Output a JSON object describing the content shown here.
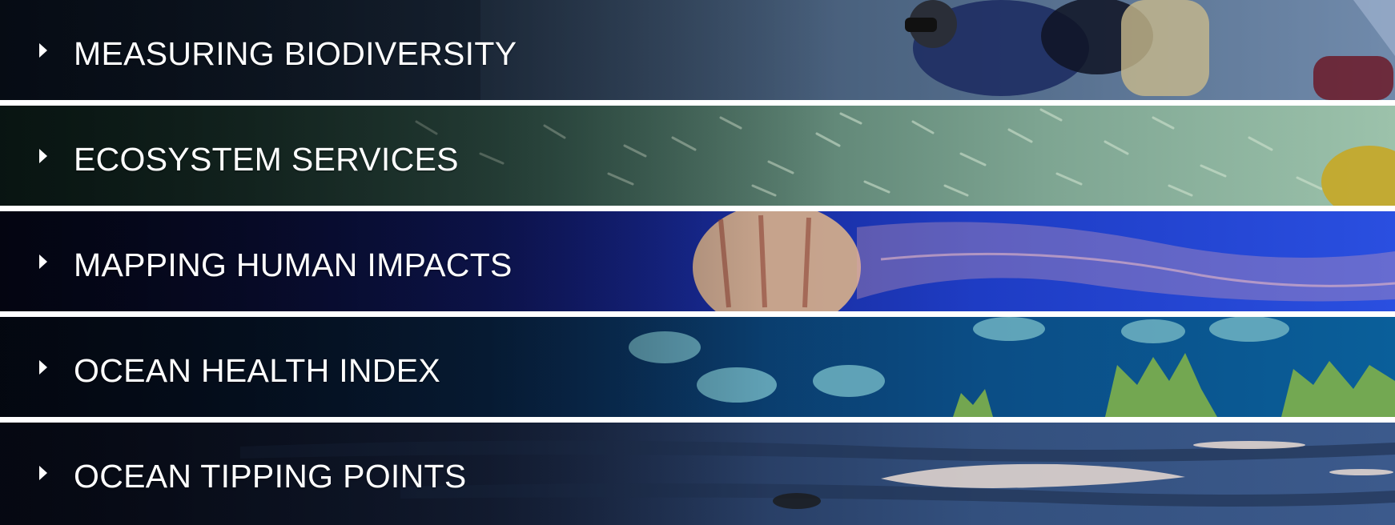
{
  "banners": [
    {
      "label": "MEASURING BIODIVERSITY",
      "image": "scuba-diver-photo",
      "colors": {
        "left": "#0e1826",
        "mid": "#3d5571",
        "right": "#6c84a6"
      }
    },
    {
      "label": "ECOSYSTEM SERVICES",
      "image": "fish-school-photo",
      "colors": {
        "left": "#13261f",
        "mid": "#4f7468",
        "right": "#8fb7a0"
      }
    },
    {
      "label": "MAPPING HUMAN IMPACTS",
      "image": "jellyfish-photo",
      "colors": {
        "left": "#070a1c",
        "mid": "#1a2a9a",
        "right": "#2447d6"
      }
    },
    {
      "label": "OCEAN HEALTH INDEX",
      "image": "reef-fish-photo",
      "colors": {
        "left": "#06101f",
        "mid": "#0b3f6f",
        "right": "#0a5f9a"
      }
    },
    {
      "label": "OCEAN TIPPING POINTS",
      "image": "tidal-flat-photo",
      "colors": {
        "left": "#0c1220",
        "mid": "#243659",
        "right": "#3a5586"
      }
    }
  ]
}
